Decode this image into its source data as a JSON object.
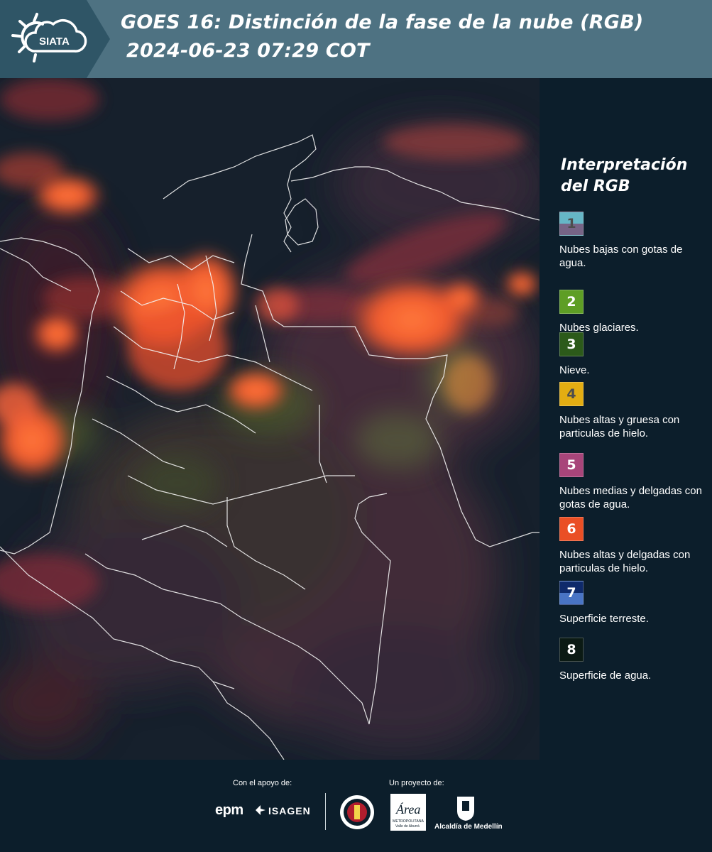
{
  "header": {
    "brand": "SIATA",
    "title_line1": "GOES 16: Distinción de la fase de la nube (RGB)",
    "title_line2": "2024-06-23 07:29 COT",
    "colors": {
      "header_bg": "#4e7282",
      "logo_bg": "#2f5566"
    }
  },
  "legend": {
    "title": "Interpretación del RGB",
    "items": [
      {
        "num": "1",
        "desc": "Nubes bajas con gotas de agua.",
        "colors": [
          "#66b6c6",
          "#776486"
        ],
        "num_color": "#4d4d4d"
      },
      {
        "num": "2",
        "desc": "Nubes glaciares.",
        "colors": [
          "#5e9e25"
        ],
        "num_color": "#ffffff"
      },
      {
        "num": "3",
        "desc": "Nieve.",
        "colors": [
          "#2c5a1a"
        ],
        "num_color": "#ffffff"
      },
      {
        "num": "4",
        "desc": "Nubes altas y gruesa con particulas de hielo.",
        "colors": [
          "#e3ad12"
        ],
        "num_color": "#4d4d4d"
      },
      {
        "num": "5",
        "desc": "Nubes medias y delgadas con gotas de agua.",
        "colors": [
          "#a8457a"
        ],
        "num_color": "#ffffff"
      },
      {
        "num": "6",
        "desc": "Nubes altas y delgadas con particulas de hielo.",
        "colors": [
          "#ea4f25"
        ],
        "num_color": "#ffffff"
      },
      {
        "num": "7",
        "desc": "Superficie terreste.",
        "colors": [
          "#0f2a6b",
          "#4974c5"
        ],
        "num_color": "#ffffff"
      },
      {
        "num": "8",
        "desc": "Superficie de agua.",
        "colors": [
          "#0b1a14"
        ],
        "num_color": "#ffffff"
      }
    ]
  },
  "footer": {
    "support_label": "Con el apoyo de:",
    "project_label": "Un proyecto de:",
    "epm": "epm",
    "isagen": "ISAGEN",
    "area_logo_word": "Área",
    "area_logo_sub": "METROPOLITANA",
    "area_logo_sub2": "Valle de Aburrá",
    "alcaldia": "Alcaldía de Medellín"
  }
}
